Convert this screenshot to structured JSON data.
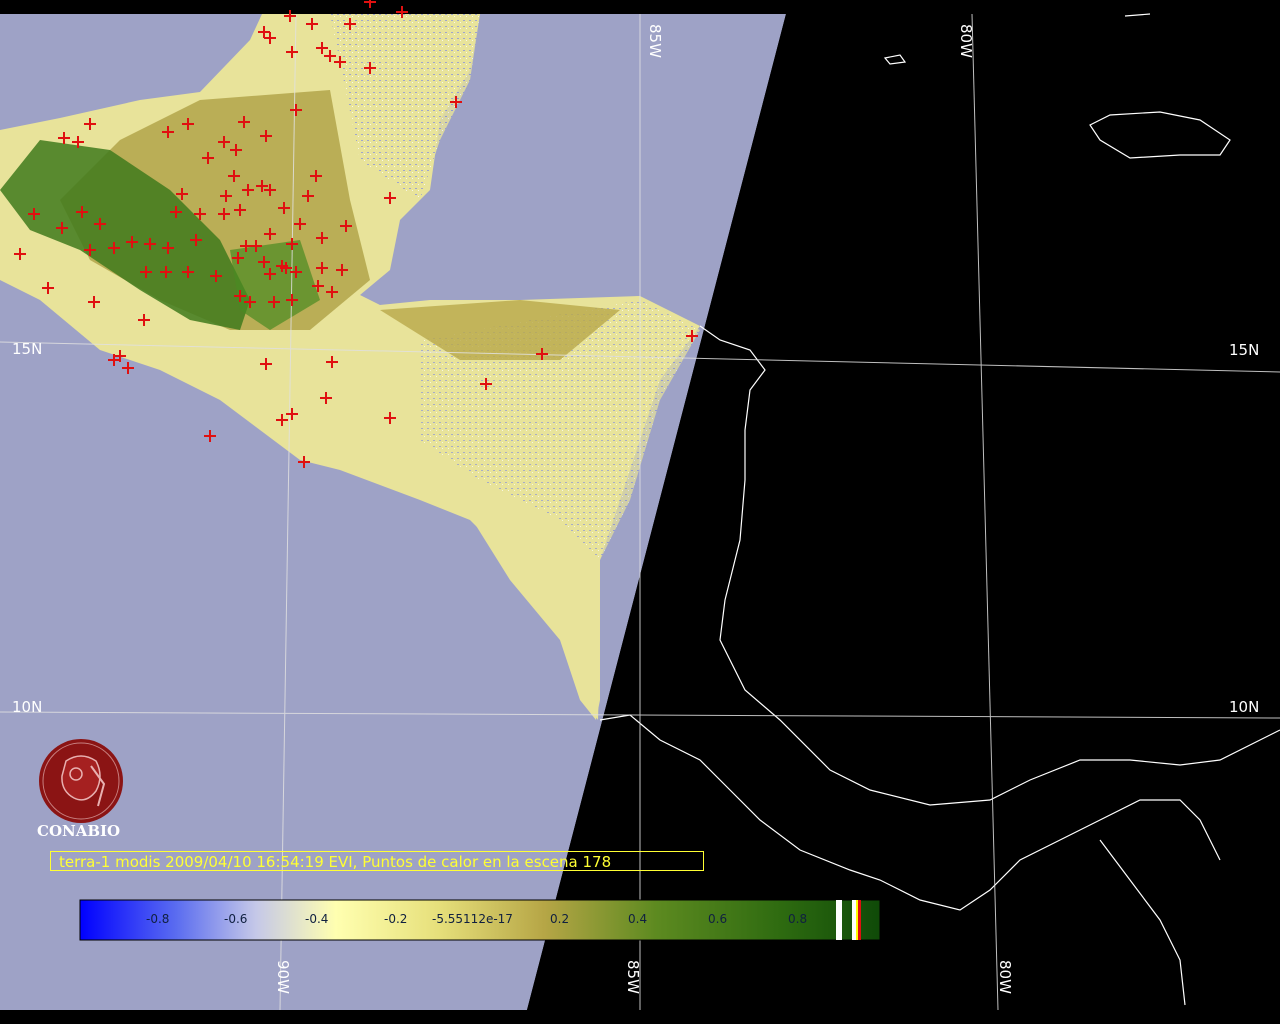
{
  "caption": "terra-1 modis 2009/04/10 16:54:19 EVI, Puntos de calor en la escena 178",
  "logo_text": "CONABIO",
  "grid_labels": {
    "lat_15_left": "15N",
    "lat_15_right": "15N",
    "lat_10_left": "10N",
    "lat_10_right": "10N",
    "lon_85_top": "85W",
    "lon_80_top": "80W",
    "lon_90_bottom": "90W",
    "lon_85_bottom": "85W",
    "lon_80_bottom": "80W"
  },
  "legend": {
    "ticks": [
      "-0.8",
      "-0.6",
      "-0.4",
      "-0.2",
      "-5.55112e-17",
      "0.2",
      "0.4",
      "0.6",
      "0.8"
    ],
    "range": [
      -1,
      1
    ]
  },
  "colors": {
    "ocean": "#9ea2c6",
    "night": "#000000",
    "land_yellow": "#e8e39a",
    "land_olive": "#b1a54a",
    "land_green": "#3f7a1c",
    "hotspot": "#e01010",
    "caption": "#ffff33",
    "logo": "#8b1414"
  }
}
